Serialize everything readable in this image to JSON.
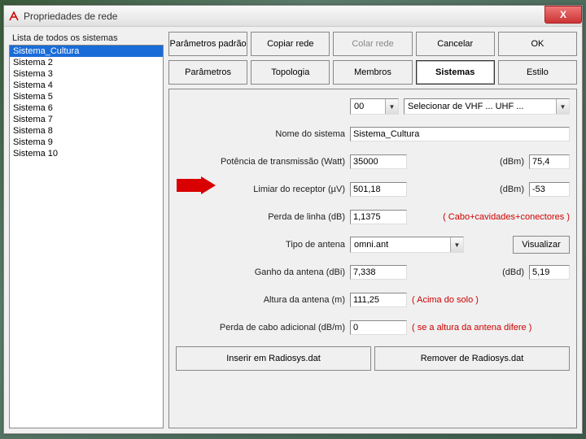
{
  "window": {
    "title": "Propriedades de rede",
    "close_icon": "X"
  },
  "left": {
    "label": "Lista de todos os sistemas",
    "items": [
      "Sistema_Cultura",
      "Sistema  2",
      "Sistema  3",
      "Sistema  4",
      "Sistema  5",
      "Sistema  6",
      "Sistema  7",
      "Sistema  8",
      "Sistema  9",
      "Sistema 10"
    ],
    "selected_index": 0
  },
  "top_buttons": {
    "row1": [
      "Parâmetros padrão",
      "Copiar rede",
      "Colar rede",
      "Cancelar",
      "OK"
    ],
    "row1_disabled": [
      false,
      false,
      true,
      false,
      false
    ],
    "row2": [
      "Parâmetros",
      "Topologia",
      "Membros",
      "Sistemas",
      "Estilo"
    ],
    "row2_active_index": 3
  },
  "form": {
    "row0": {
      "combo1": "00",
      "combo2": "Selecionar de VHF ... UHF ..."
    },
    "system_name": {
      "label": "Nome do sistema",
      "value": "Sistema_Cultura"
    },
    "tx_power": {
      "label": "Potência de transmissão (Watt)",
      "value": "35000",
      "dbm_label": "(dBm)",
      "dbm_value": "75,4"
    },
    "rx_thresh": {
      "label": "Limiar do receptor (µV)",
      "value": "501,18",
      "dbm_label": "(dBm)",
      "dbm_value": "-53"
    },
    "line_loss": {
      "label": "Perda de linha (dB)",
      "value": "1,1375",
      "note": "( Cabo+cavidades+conectores )"
    },
    "ant_type": {
      "label": "Tipo de antena",
      "value": "omni.ant",
      "view_btn": "Visualizar"
    },
    "ant_gain": {
      "label": "Ganho da antena (dBi)",
      "value": "7,338",
      "dbd_label": "(dBd)",
      "dbd_value": "5,19"
    },
    "ant_height": {
      "label": "Altura da antena (m)",
      "value": "111,25",
      "note": "( Acima do solo )"
    },
    "cable_loss": {
      "label": "Perda de cabo adicional (dB/m)",
      "value": "0",
      "note": "( se a altura da antena difere )"
    }
  },
  "bottom_buttons": [
    "Inserir em Radiosys.dat",
    "Remover de Radiosys.dat"
  ]
}
